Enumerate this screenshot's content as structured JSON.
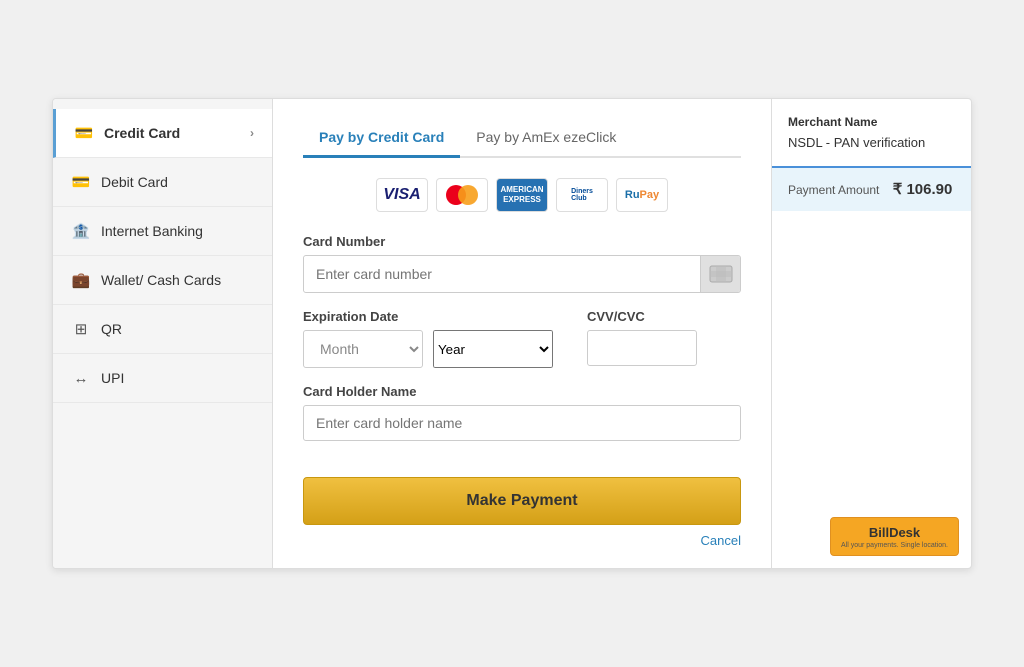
{
  "sidebar": {
    "items": [
      {
        "id": "credit-card",
        "label": "Credit Card",
        "icon": "💳",
        "active": true,
        "hasChevron": true
      },
      {
        "id": "debit-card",
        "label": "Debit Card",
        "icon": "💳",
        "active": false,
        "hasChevron": false
      },
      {
        "id": "internet-banking",
        "label": "Internet Banking",
        "icon": "🏦",
        "active": false,
        "hasChevron": false
      },
      {
        "id": "wallet-cash-cards",
        "label": "Wallet/ Cash Cards",
        "icon": "💼",
        "active": false,
        "hasChevron": false
      },
      {
        "id": "qr",
        "label": "QR",
        "icon": "⊞",
        "active": false,
        "hasChevron": false
      },
      {
        "id": "upi",
        "label": "UPI",
        "icon": "↔",
        "active": false,
        "hasChevron": false
      }
    ]
  },
  "tabs": [
    {
      "id": "credit-card-tab",
      "label": "Pay by Credit Card",
      "active": true
    },
    {
      "id": "amex-tab",
      "label": "Pay by AmEx ezeClick",
      "active": false
    }
  ],
  "form": {
    "card_number_label": "Card Number",
    "card_number_placeholder": "Enter card number",
    "expiration_date_label": "Expiration Date",
    "month_placeholder": "Month",
    "year_placeholder": "Year",
    "cvvcvc_label": "CVV/CVC",
    "cvv_placeholder": "",
    "card_holder_label": "Card Holder Name",
    "card_holder_placeholder": "Enter card holder name",
    "make_payment_label": "Make Payment",
    "cancel_label": "Cancel"
  },
  "merchant": {
    "name_label": "Merchant Name",
    "name_value": "NSDL - PAN verification",
    "amount_label": "Payment Amount",
    "amount_value": "₹ 106.90"
  },
  "billdesk": {
    "label": "BillDesk",
    "sublabel": "All your payments. Single location."
  }
}
